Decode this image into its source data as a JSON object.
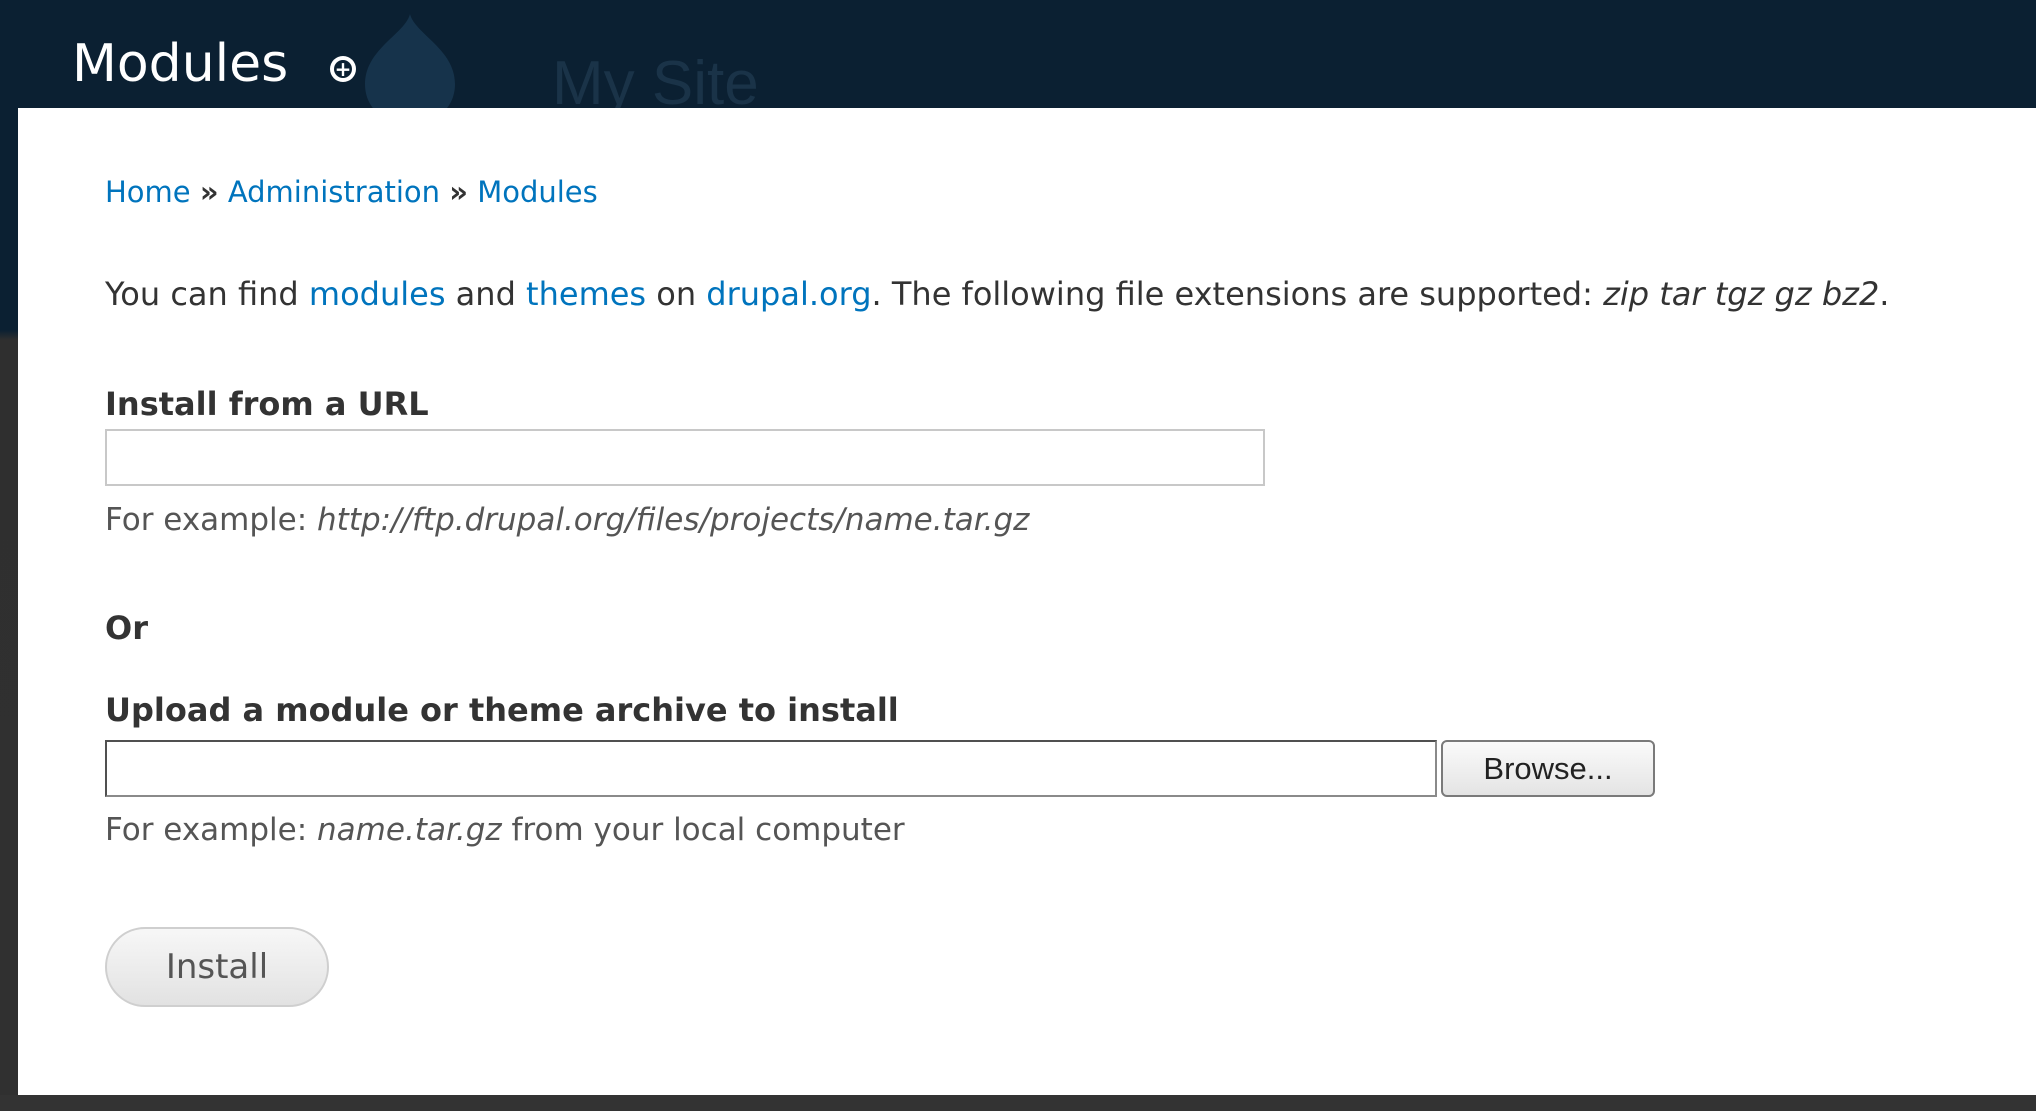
{
  "overlay": {
    "title": "Modules",
    "shortcut_icon": "add-shortcut-icon"
  },
  "site": {
    "name": "My Site"
  },
  "breadcrumb": {
    "items": [
      "Home",
      "Administration",
      "Modules"
    ],
    "separator": "»"
  },
  "intro": {
    "prefix": "You can find ",
    "link_modules": "modules",
    "and": " and ",
    "link_themes": "themes",
    "on": " on ",
    "link_drupal": "drupal.org",
    "suffix": ". The following file extensions are supported: ",
    "extensions": "zip tar tgz gz bz2",
    "end": "."
  },
  "url_section": {
    "label": "Install from a URL",
    "value": "",
    "desc_prefix": "For example: ",
    "desc_example": "http://ftp.drupal.org/files/projects/name.tar.gz"
  },
  "or_label": "Or",
  "upload_section": {
    "label": "Upload a module or theme archive to install",
    "browse_label": "Browse...",
    "desc_prefix": "For example: ",
    "desc_example": "name.tar.gz",
    "desc_suffix": " from your local computer"
  },
  "install_button": "Install",
  "colors": {
    "header_bg": "#0b2032",
    "link": "#0074bd",
    "content_bg": "#ffffff"
  }
}
